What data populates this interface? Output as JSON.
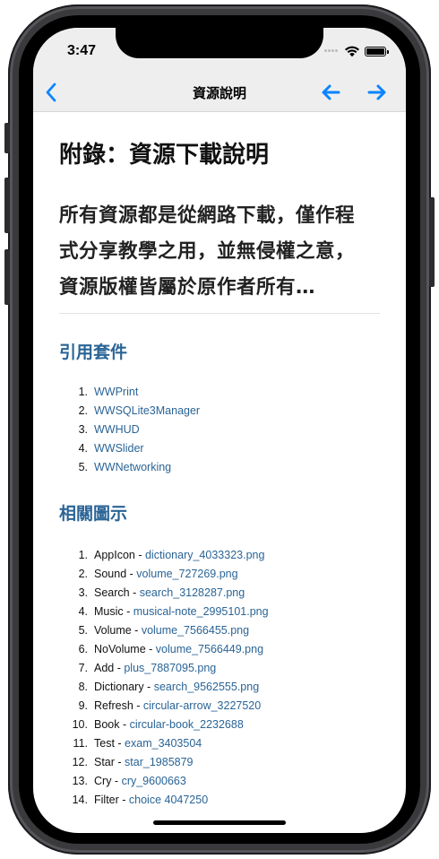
{
  "status": {
    "time": "3:47"
  },
  "nav": {
    "title": "資源說明"
  },
  "content": {
    "heading": "附錄：資源下載說明",
    "lead_lines": [
      "所有資源都是從網路下載，僅作程",
      "式分享教學之用，並無侵權之意，",
      "資源版權皆屬於原作者所有…"
    ],
    "packages_title": "引用套件",
    "packages": [
      {
        "num": "1.",
        "label": "WWPrint"
      },
      {
        "num": "2.",
        "label": "WWSQLite3Manager"
      },
      {
        "num": "3.",
        "label": "WWHUD"
      },
      {
        "num": "4.",
        "label": "WWSlider"
      },
      {
        "num": "5.",
        "label": "WWNetworking"
      }
    ],
    "icons_title": "相關圖示",
    "icons": [
      {
        "num": "1.",
        "name": "AppIcon",
        "sep": " - ",
        "file": "dictionary_4033323.png"
      },
      {
        "num": "2.",
        "name": "Sound",
        "sep": " - ",
        "file": "volume_727269.png"
      },
      {
        "num": "3.",
        "name": "Search",
        "sep": " - ",
        "file": "search_3128287.png"
      },
      {
        "num": "4.",
        "name": "Music",
        "sep": " - ",
        "file": "musical-note_2995101.png"
      },
      {
        "num": "5.",
        "name": "Volume",
        "sep": " - ",
        "file": "volume_7566455.png"
      },
      {
        "num": "6.",
        "name": "NoVolume",
        "sep": " - ",
        "file": "volume_7566449.png"
      },
      {
        "num": "7.",
        "name": "Add",
        "sep": " - ",
        "file": "plus_7887095.png"
      },
      {
        "num": "8.",
        "name": "Dictionary",
        "sep": " - ",
        "file": "search_9562555.png"
      },
      {
        "num": "9.",
        "name": "Refresh",
        "sep": " - ",
        "file": "circular-arrow_3227520"
      },
      {
        "num": "10.",
        "name": "Book",
        "sep": " - ",
        "file": "circular-book_2232688"
      },
      {
        "num": "11.",
        "name": "Test",
        "sep": " - ",
        "file": "exam_3403504"
      },
      {
        "num": "12.",
        "name": "Star",
        "sep": " - ",
        "file": "star_1985879"
      },
      {
        "num": "13.",
        "name": "Cry",
        "sep": " - ",
        "file": "cry_9600663"
      },
      {
        "num": "14.",
        "name": "Filter",
        "sep": " - ",
        "file": "choice 4047250"
      }
    ]
  },
  "colors": {
    "link": "#2a6496",
    "nav_tint": "#0a84ff",
    "bar_bg": "#eeeeef"
  },
  "icons_used": [
    "chevron-left-icon",
    "arrow-left-icon",
    "arrow-right-icon",
    "wifi-icon",
    "battery-icon",
    "signal-dots-icon"
  ]
}
